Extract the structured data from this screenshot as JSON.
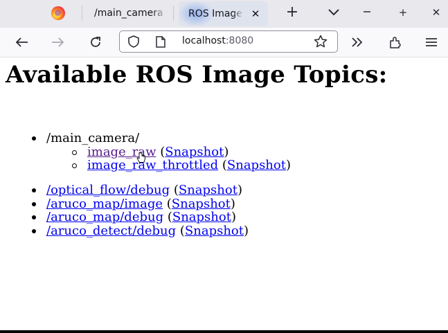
{
  "tabs": [
    {
      "label": "/main_camera",
      "active": false
    },
    {
      "label": "ROS Image",
      "active": true
    }
  ],
  "navbar": {
    "url_host": "localhost",
    "url_port": ":8080"
  },
  "page": {
    "heading": "Available ROS Image Topics:",
    "groups": [
      {
        "label": "/main_camera/",
        "items": [
          {
            "topic": "image_raw",
            "snapshot": "Snapshot"
          },
          {
            "topic": "image_raw_throttled",
            "snapshot": "Snapshot"
          }
        ]
      }
    ],
    "topics": [
      {
        "topic": "/optical_flow/debug",
        "snapshot": "Snapshot"
      },
      {
        "topic": "/aruco_map/image",
        "snapshot": "Snapshot"
      },
      {
        "topic": "/aruco_map/debug",
        "snapshot": "Snapshot"
      },
      {
        "topic": "/aruco_detect/debug",
        "snapshot": "Snapshot"
      }
    ]
  },
  "colors": {
    "link": "#0000ee",
    "visited_link": "#551a8b",
    "active_tab": "#dfe3ee",
    "tab_strip": "#e9e8ec"
  },
  "icons": [
    "firefox-logo-icon",
    "tab-close-icon",
    "new-tab-icon",
    "list-tabs-icon",
    "minimize-icon",
    "maximize-icon",
    "window-close-icon",
    "back-icon",
    "forward-icon",
    "reload-icon",
    "shield-icon",
    "page-icon",
    "bookmark-star-icon",
    "overflow-icon",
    "extensions-icon",
    "menu-icon",
    "mouse-pointer-icon"
  ]
}
